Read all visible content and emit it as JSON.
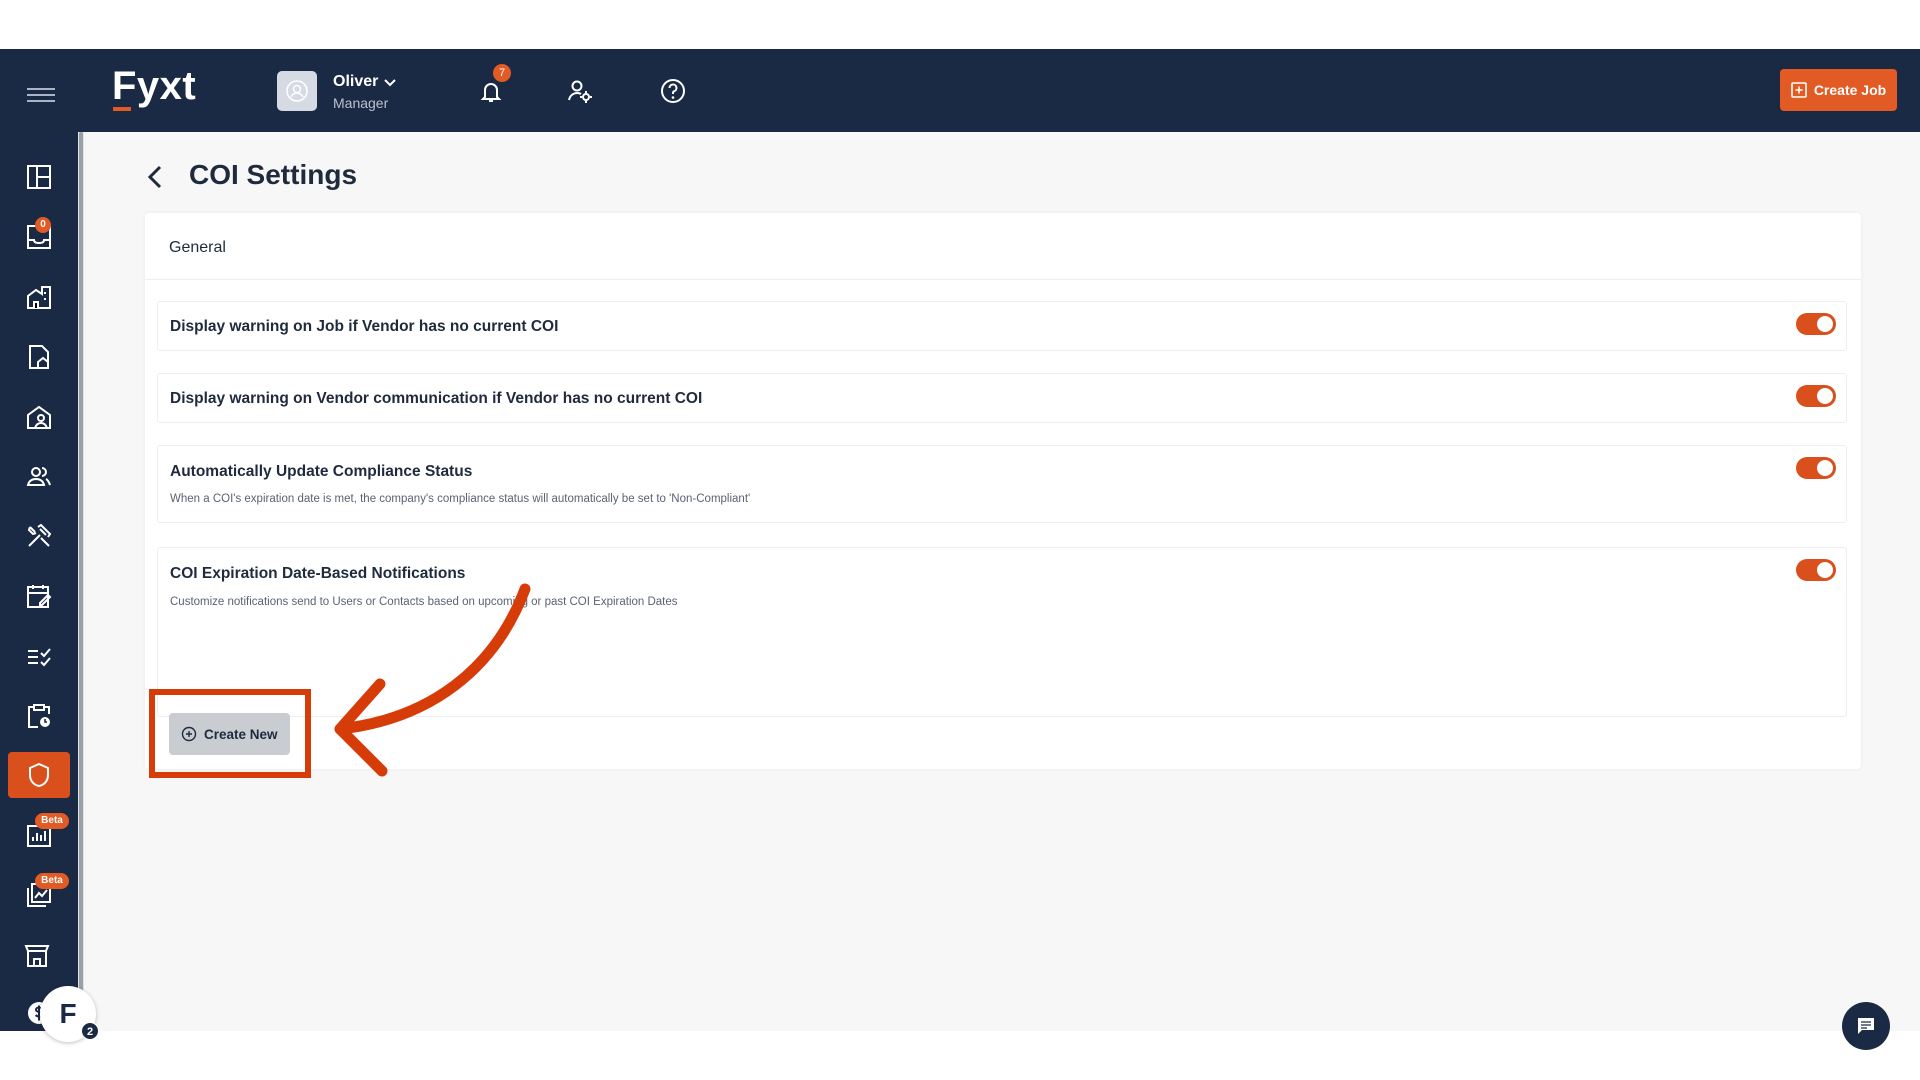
{
  "app": {
    "logo": "Fyxt"
  },
  "user": {
    "name": "Oliver",
    "role": "Manager"
  },
  "header": {
    "notification_count": "7",
    "create_job_label": "Create Job"
  },
  "sidebar": {
    "inbox_badge": "0",
    "reports_badge": "Beta",
    "dashboards_badge": "Beta",
    "items": [
      "dashboard-icon",
      "inbox-icon",
      "properties-icon",
      "leases-icon",
      "tenants-icon",
      "contacts-icon",
      "jobs-icon",
      "schedule-icon",
      "tasks-icon",
      "inspections-icon",
      "coi-shield-icon",
      "reports-icon",
      "dashboards-icon",
      "vendors-icon",
      "billing-icon"
    ]
  },
  "page": {
    "title": "COI Settings"
  },
  "settings": {
    "section": "General",
    "rows": [
      {
        "title": "Display warning on Job if Vendor has no current COI",
        "description": "",
        "enabled": true
      },
      {
        "title": "Display warning on Vendor communication if Vendor has no current COI",
        "description": "",
        "enabled": true
      },
      {
        "title": "Automatically Update Compliance Status",
        "description": "When a COI's expiration date is met, the company's compliance status will automatically be set to 'Non-Compliant'",
        "enabled": true
      },
      {
        "title": "COI Expiration Date-Based Notifications",
        "description": "Customize notifications send to Users or Contacts based on upcoming or past COI Expiration Dates",
        "enabled": true
      }
    ],
    "create_new_label": "Create New"
  },
  "widget": {
    "letter": "F",
    "count": "2"
  },
  "colors": {
    "navy": "#1b2a44",
    "accent": "#e25a24",
    "highlight": "#d63c08"
  }
}
